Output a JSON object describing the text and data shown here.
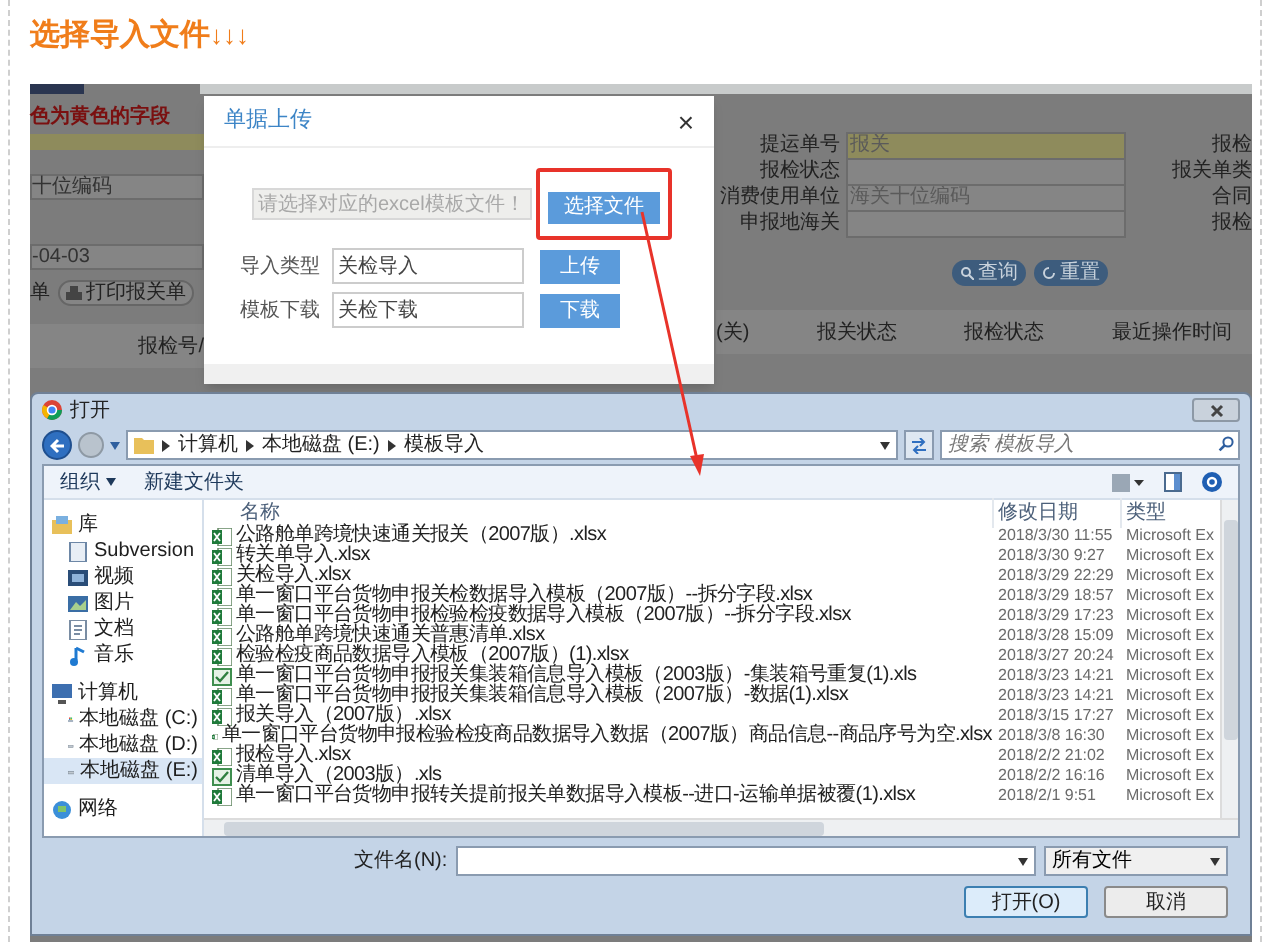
{
  "title": {
    "text": "选择导入文件",
    "arrows": "↓↓↓"
  },
  "background_form": {
    "notice": "色为黄色的字段",
    "left_values": [
      "十位编码",
      "-04-03"
    ],
    "left_label": "单",
    "print_button": "打印报关单",
    "rows": [
      {
        "label": "提运单号",
        "placeholder": "报关",
        "required": true,
        "right_label": "报检"
      },
      {
        "label": "报检状态",
        "required": false,
        "right_label": "报关单类"
      },
      {
        "label": "消费使用单位",
        "placeholder": "海关十位编码",
        "required": false,
        "right_label": "合同"
      },
      {
        "label": "申报地海关",
        "required": false,
        "right_label": "报检"
      }
    ],
    "search_buttons": [
      {
        "label": "查询",
        "kind": "search"
      },
      {
        "label": "重置",
        "kind": "reset"
      }
    ],
    "table_header_left": "报检号/",
    "table_headers_right": [
      "(关)",
      "报关状态",
      "报检状态",
      "最近操作时间"
    ]
  },
  "modal": {
    "title": "单据上传",
    "close": "×",
    "file_field": {
      "placeholder": "请选择对应的excel模板文件！"
    },
    "choose_button": "选择文件",
    "choose_highlighted": true,
    "rows": [
      {
        "label": "导入类型",
        "value": "关检导入",
        "button": "上传"
      },
      {
        "label": "模板下载",
        "value": "关检下载",
        "button": "下载"
      }
    ]
  },
  "open_dialog": {
    "title": "打开",
    "breadcrumb": [
      "计算机",
      "本地磁盘 (E:)",
      "模板导入"
    ],
    "search": {
      "placeholder": "搜索 模板导入"
    },
    "toolbar": [
      {
        "label": "组织",
        "dropdown": true
      },
      {
        "label": "新建文件夹",
        "dropdown": false
      }
    ],
    "sidebar": [
      {
        "label": "库",
        "kind": "library",
        "selected": false,
        "children": [
          {
            "label": "Subversion",
            "kind": "svn",
            "selected": false
          },
          {
            "label": "视频",
            "kind": "video",
            "selected": false
          },
          {
            "label": "图片",
            "kind": "picture",
            "selected": false
          },
          {
            "label": "文档",
            "kind": "document",
            "selected": false
          },
          {
            "label": "音乐",
            "kind": "music",
            "selected": false
          }
        ]
      },
      {
        "label": "计算机",
        "kind": "computer",
        "selected": false,
        "children": [
          {
            "label": "本地磁盘 (C:)",
            "kind": "system-drive",
            "selected": false
          },
          {
            "label": "本地磁盘 (D:)",
            "kind": "drive",
            "selected": false
          },
          {
            "label": "本地磁盘 (E:)",
            "kind": "drive",
            "selected": true
          }
        ]
      },
      {
        "label": "网络",
        "kind": "network",
        "selected": false
      }
    ],
    "columns": [
      "名称",
      "修改日期",
      "类型"
    ],
    "files": [
      {
        "name": "公路舱单跨境快速通关报关（2007版）.xlsx",
        "date": "2018/3/30 11:55",
        "type": "Microsoft Ex",
        "kind": "xlsx"
      },
      {
        "name": "转关单导入.xlsx",
        "date": "2018/3/30 9:27",
        "type": "Microsoft Ex",
        "kind": "xlsx"
      },
      {
        "name": "关检导入.xlsx",
        "date": "2018/3/29 22:29",
        "type": "Microsoft Ex",
        "kind": "xlsx"
      },
      {
        "name": "单一窗口平台货物申报关检数据导入模板（2007版）--拆分字段.xlsx",
        "date": "2018/3/29 18:57",
        "type": "Microsoft Ex",
        "kind": "xlsx"
      },
      {
        "name": "单一窗口平台货物申报检验检疫数据导入模板（2007版）--拆分字段.xlsx",
        "date": "2018/3/29 17:23",
        "type": "Microsoft Ex",
        "kind": "xlsx"
      },
      {
        "name": "公路舱单跨境快速通关普惠清单.xlsx",
        "date": "2018/3/28 15:09",
        "type": "Microsoft Ex",
        "kind": "xlsx"
      },
      {
        "name": "检验检疫商品数据导入模板（2007版）(1).xlsx",
        "date": "2018/3/27 20:24",
        "type": "Microsoft Ex",
        "kind": "xlsx"
      },
      {
        "name": "单一窗口平台货物申报报关集装箱信息导入模板（2003版）-集装箱号重复(1).xls",
        "date": "2018/3/23 14:21",
        "type": "Microsoft Ex",
        "kind": "xls"
      },
      {
        "name": "单一窗口平台货物申报报关集装箱信息导入模板（2007版）-数据(1).xlsx",
        "date": "2018/3/23 14:21",
        "type": "Microsoft Ex",
        "kind": "xlsx"
      },
      {
        "name": "报关导入（2007版）.xlsx",
        "date": "2018/3/15 17:27",
        "type": "Microsoft Ex",
        "kind": "xlsx"
      },
      {
        "name": "单一窗口平台货物申报检验检疫商品数据导入数据（2007版）商品信息--商品序号为空.xlsx",
        "date": "2018/3/8 16:30",
        "type": "Microsoft Ex",
        "kind": "xlsx"
      },
      {
        "name": "报检导入.xlsx",
        "date": "2018/2/2 21:02",
        "type": "Microsoft Ex",
        "kind": "xlsx"
      },
      {
        "name": "清单导入（2003版）.xls",
        "date": "2018/2/2 16:16",
        "type": "Microsoft Ex",
        "kind": "xls"
      },
      {
        "name": "单一窗口平台货物申报转关提前报关单数据导入模板--进口-运输单据被覆(1).xlsx",
        "date": "2018/2/1 9:51",
        "type": "Microsoft Ex",
        "kind": "xlsx"
      }
    ],
    "filename_label": "文件名(N):",
    "filter": "所有文件",
    "buttons": [
      {
        "label": "打开(O)",
        "primary": true
      },
      {
        "label": "取消",
        "primary": false
      }
    ]
  }
}
